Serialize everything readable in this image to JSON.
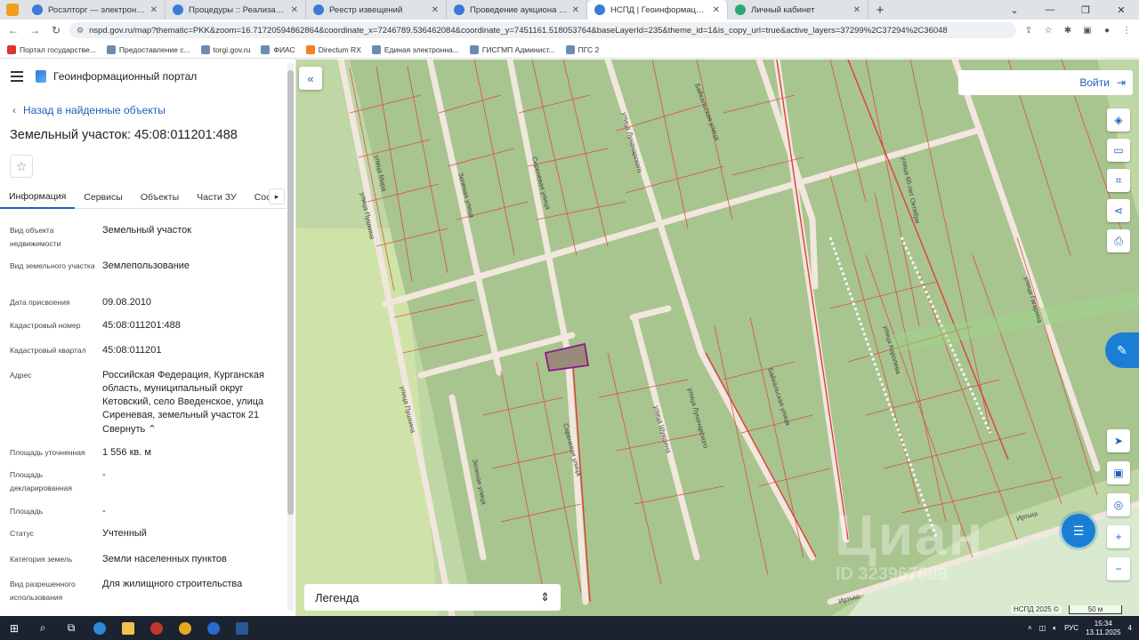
{
  "browser": {
    "tabs": [
      {
        "title": "Росэлторг — электронная торгов"
      },
      {
        "title": "Процедуры :: Реализация госим"
      },
      {
        "title": "Реестр извещений"
      },
      {
        "title": "Проведение аукциона в электр"
      },
      {
        "title": "НСПД | Геоинформационный п",
        "active": true
      },
      {
        "title": "Личный кабинет"
      }
    ],
    "url": "nspd.gov.ru/map?thematic=PKK&zoom=16.71720594862864&coordinate_x=7246789.536462084&coordinate_y=7451161.518053764&baseLayerId=235&theme_id=1&is_copy_url=true&active_layers=37299%2C37294%2C36048",
    "bookmarks": [
      "Портал государстве...",
      "Предоставление с...",
      "torgi.gov.ru",
      "ФИАС",
      "Directum RX",
      "Единая электронна...",
      "ГИСГМП Админист...",
      "ПГС 2"
    ]
  },
  "panel": {
    "app_title": "Геоинформационный портал",
    "back_label": "Назад в найденные объекты",
    "object_title": "Земельный участок: 45:08:011201:488",
    "tabs": [
      "Информация",
      "Сервисы",
      "Объекты",
      "Части ЗУ",
      "Соста"
    ],
    "properties": [
      {
        "key": "Вид объекта недвижимости",
        "value": "Земельный участок"
      },
      {
        "key": "Вид земельного участка",
        "value": "Землепользование"
      },
      {
        "key": "Дата присвоения",
        "value": "09.08.2010"
      },
      {
        "key": "Кадастровый номер",
        "value": "45:08:011201:488"
      },
      {
        "key": "Кадастровый квартал",
        "value": "45:08:011201"
      },
      {
        "key": "Адрес",
        "value": "Российская Федерация, Курганская область, муниципальный округ Кетовский, село Введенское, улица Сиреневая, земельный участок 21"
      },
      {
        "key": "Площадь уточненная",
        "value": "1 556 кв. м"
      },
      {
        "key": "Площадь декларированная",
        "value": "-"
      },
      {
        "key": "Площадь",
        "value": "-"
      },
      {
        "key": "Статус",
        "value": "Учтенный"
      },
      {
        "key": "Категория земель",
        "value": "Земли населенных пунктов"
      },
      {
        "key": "Вид разрешенного использования",
        "value": "Для жилищного строительства"
      }
    ],
    "collapse_label": "Свернуть"
  },
  "map": {
    "login_label": "Войти",
    "legend_label": "Легенда",
    "credit": "НСПД 2025 ©",
    "scale_label": "50 м",
    "watermark": "Циан",
    "watermark_id": "ID 323967689",
    "streets": [
      "улица Мира",
      "улица Пушкина",
      "Зеленая улица",
      "Сиреневая улица",
      "улица Луначарского",
      "Байкальская улица",
      "улица Гагарина",
      "улица Шукшина",
      "улица Королева",
      "улица 60-лет Октября",
      "Иртыш"
    ]
  },
  "taskbar": {
    "lang": "РУС",
    "time": "15:34",
    "date": "13.11.2025",
    "notifications": "4"
  },
  "colors": {
    "accent": "#1f5fbf",
    "map_bg": "#c8dcb0",
    "parcel_line": "#e03c3c",
    "road": "#f1e7dd",
    "selected": "#8b1a8b"
  }
}
